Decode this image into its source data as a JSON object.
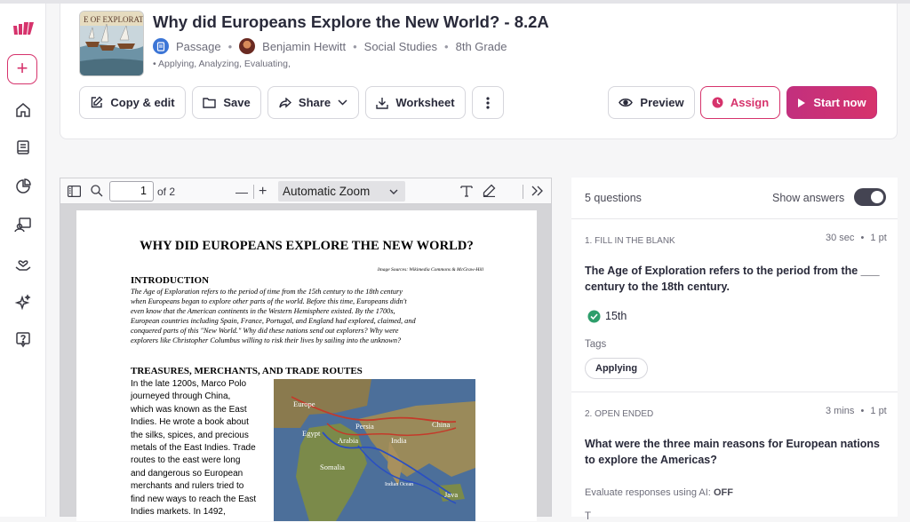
{
  "header": {
    "title": "Why did Europeans Explore the New World? - 8.2A",
    "resource_type": "Passage",
    "author": "Benjamin Hewitt",
    "subject": "Social Studies",
    "grade": "8th Grade",
    "skills": "• Applying, Analyzing, Evaluating,",
    "thumbnail_text": "E OF EXPLORAT"
  },
  "toolbar": {
    "copy_edit": "Copy & edit",
    "save": "Save",
    "share": "Share",
    "worksheet": "Worksheet",
    "preview": "Preview",
    "assign": "Assign",
    "start_now": "Start now"
  },
  "sidebar": {
    "items": [
      "create-button",
      "home",
      "library",
      "reports",
      "classes",
      "rewards",
      "ai",
      "help"
    ]
  },
  "pdf_viewer": {
    "page_number": "1",
    "page_total": "of 2",
    "zoom": "Automatic Zoom",
    "minus": "—",
    "plus": "+"
  },
  "document": {
    "title": "WHY DID EUROPEANS EXPLORE THE NEW WORLD?",
    "image_sources": "Image Sources: Wikimedia Commons & McGraw-Hill",
    "section1_heading": "INTRODUCTION",
    "intro_lines": [
      "The Age of Exploration refers to the period of time from the 15th century to the 18th century",
      "when Europeans began to explore other parts of the world. Before this time, Europeans didn't",
      "even know that the American continents in the Western Hemisphere existed. By the 1700s,",
      "European countries including Spain, France, Portugal, and England had explored, claimed, and",
      "conquered parts of this \"New World.\" Why did these nations send out explorers? Why were",
      "explorers like Christopher Columbus willing to risk their lives by sailing into the unknown?"
    ],
    "section2_heading": "TREASURES, MERCHANTS, AND TRADE ROUTES",
    "body_lines": [
      "In the late 1200s, Marco Polo",
      "journeyed through China,",
      "which was known as the East",
      "Indies. He wrote a book about",
      "the silks, spices, and precious",
      "metals of the East Indies. Trade",
      "routes to the east were long",
      "and dangerous so European",
      "merchants and rulers tried to",
      "find new ways to reach the East",
      "Indies markets. In 1492,"
    ],
    "map_labels": [
      "Europe",
      "Persia",
      "Egypt",
      "Arabia",
      "India",
      "China",
      "Somalia",
      "Indian Ocean",
      "Java"
    ]
  },
  "questions": {
    "count_label": "5 questions",
    "show_answers_label": "Show answers",
    "show_answers_on": true,
    "items": [
      {
        "type_label": "1. FILL IN THE BLANK",
        "time": "30 sec",
        "points": "1 pt",
        "text_line1": "The Age of Exploration refers to the period from the ___",
        "text_line2": "century to the 18th century.",
        "answer": "15th",
        "tags_label": "Tags",
        "tag": "Applying"
      },
      {
        "type_label": "2. OPEN ENDED",
        "time": "3 mins",
        "points": "1 pt",
        "text_line1": "What were the three main reasons for European nations",
        "text_line2": "to explore the Americas?",
        "ai_eval_label": "Evaluate responses using AI:",
        "ai_eval_value": "OFF",
        "tags_label": "T"
      }
    ]
  },
  "colors": {
    "accent": "#d6336c",
    "start_button": "#c2307e",
    "answer_check": "#2e9e6b",
    "doc_icon": "#3c75d6"
  }
}
